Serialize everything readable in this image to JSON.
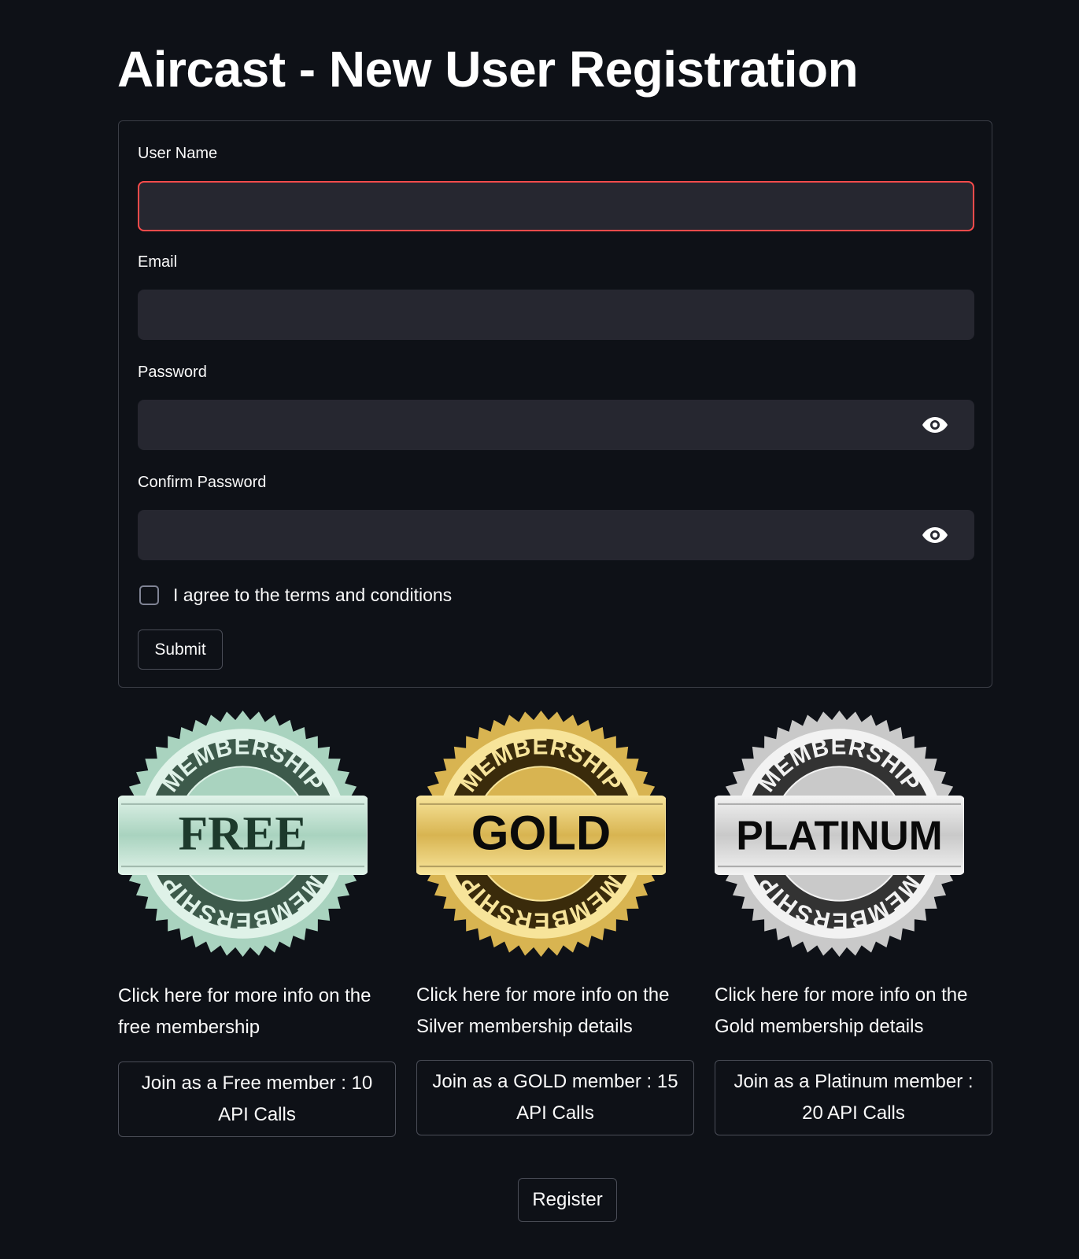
{
  "page": {
    "title": "Aircast - New User Registration"
  },
  "form": {
    "username": {
      "label": "User Name",
      "value": ""
    },
    "email": {
      "label": "Email",
      "value": ""
    },
    "password": {
      "label": "Password",
      "value": ""
    },
    "confirm_password": {
      "label": "Confirm Password",
      "value": ""
    },
    "terms": {
      "label": "I agree to the terms and conditions",
      "checked": false
    },
    "submit_label": "Submit"
  },
  "tiers": [
    {
      "badge": {
        "top_text": "MEMBERSHIP",
        "center_text": "FREE",
        "bottom_text": "MEMBERSHIP",
        "main_color": "#a9d3bf",
        "dark_color": "#3d5a4b",
        "light_color": "#dff2e8"
      },
      "info_text": "Click here for more info on the free membership",
      "button_label": "Join as a Free member : 10 API Calls"
    },
    {
      "badge": {
        "top_text": "MEMBERSHIP",
        "center_text": "GOLD",
        "bottom_text": "MEMBERSHIP",
        "main_color": "#d8b451",
        "dark_color": "#3a2b0b",
        "light_color": "#f7e49a"
      },
      "info_text": "Click here for more info on the Silver membership details",
      "button_label": "Join as a GOLD member : 15 API Calls"
    },
    {
      "badge": {
        "top_text": "MEMBERSHIP",
        "center_text": "PLATINUM",
        "bottom_text": "MEMBERSHIP",
        "main_color": "#c9c9c9",
        "dark_color": "#333333",
        "light_color": "#f2f2f2"
      },
      "info_text": "Click here for more info on the Gold membership details",
      "button_label": "Join as a Platinum member : 20 API Calls"
    }
  ],
  "register_label": "Register",
  "colors": {
    "background": "#0e1117",
    "input_bg": "#262730",
    "focus_border": "#ff4b4b"
  }
}
